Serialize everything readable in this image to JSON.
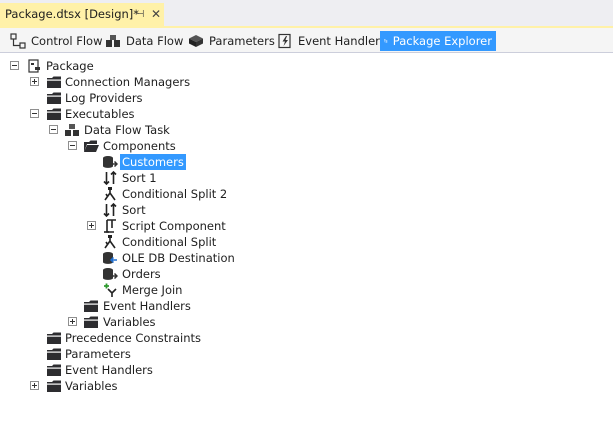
{
  "document_tab": {
    "title": "Package.dtsx [Design]*",
    "pin_glyph": "⊣",
    "close_glyph": "✕"
  },
  "designer_tabs": [
    {
      "label": "Control Flow",
      "icon": "control-flow-icon"
    },
    {
      "label": "Data Flow",
      "icon": "data-flow-icon"
    },
    {
      "label": "Parameters",
      "icon": "parameters-icon"
    },
    {
      "label": "Event Handlers",
      "icon": "event-handlers-icon"
    },
    {
      "label": "Package Explorer",
      "icon": "package-explorer-icon",
      "active": true
    }
  ],
  "tree": {
    "package": "Package",
    "connection_managers": "Connection Managers",
    "log_providers": "Log Providers",
    "executables": "Executables",
    "data_flow_task": "Data Flow Task",
    "components": "Components",
    "items": [
      {
        "label": "Customers",
        "icon": "source-icon",
        "selected": true
      },
      {
        "label": "Sort 1",
        "icon": "sort-icon"
      },
      {
        "label": "Conditional Split 2",
        "icon": "conditional-split-icon"
      },
      {
        "label": "Sort",
        "icon": "sort-icon"
      },
      {
        "label": "Script Component",
        "icon": "script-component-icon",
        "expandable": true
      },
      {
        "label": "Conditional Split",
        "icon": "conditional-split-icon"
      },
      {
        "label": "OLE DB Destination",
        "icon": "destination-icon"
      },
      {
        "label": "Orders",
        "icon": "source-icon"
      },
      {
        "label": "Merge Join",
        "icon": "merge-join-icon"
      }
    ],
    "task_event_handlers": "Event Handlers",
    "task_variables": "Variables",
    "precedence_constraints": "Precedence Constraints",
    "parameters": "Parameters",
    "event_handlers": "Event Handlers",
    "variables": "Variables"
  },
  "colors": {
    "accent": "#3399ff",
    "doc_tab": "#fff1a8",
    "folder": "#2d2d30"
  }
}
